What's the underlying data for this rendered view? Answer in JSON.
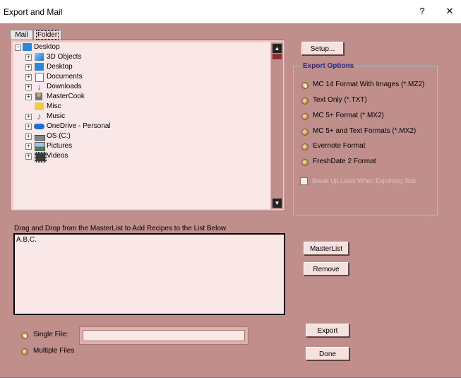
{
  "window": {
    "title": "Export and Mail",
    "help": "?",
    "close": "✕"
  },
  "tabs": [
    {
      "label": "Mail"
    },
    {
      "label": "Folder"
    }
  ],
  "tree": [
    {
      "label": "Desktop",
      "icon": "desktop-icon",
      "expander": "−"
    },
    {
      "label": "3D Objects",
      "icon": "cube-icon",
      "expander": "+"
    },
    {
      "label": "Desktop",
      "icon": "desktop-icon",
      "expander": "+"
    },
    {
      "label": "Documents",
      "icon": "document-icon",
      "expander": "+"
    },
    {
      "label": "Downloads",
      "icon": "download-icon",
      "expander": "+"
    },
    {
      "label": "MasterCook",
      "icon": "user-icon",
      "expander": "+"
    },
    {
      "label": "Misc",
      "icon": "folder-icon",
      "expander": ""
    },
    {
      "label": "Music",
      "icon": "music-icon",
      "expander": "+"
    },
    {
      "label": "OneDrive - Personal",
      "icon": "cloud-icon",
      "expander": "+"
    },
    {
      "label": "OS (C:)",
      "icon": "drive-icon",
      "expander": "+"
    },
    {
      "label": "Pictures",
      "icon": "picture-icon",
      "expander": "+"
    },
    {
      "label": "Videos",
      "icon": "video-icon",
      "expander": "+"
    }
  ],
  "scroll": {
    "up": "▲",
    "down": "▼"
  },
  "buttons": {
    "setup": "Setup...",
    "masterlist": "MasterList",
    "remove": "Remove",
    "export": "Export",
    "done": "Done"
  },
  "export_options": {
    "title": "Export Options",
    "options": [
      {
        "label": "MC 14 Format With Images (*.MZ2)",
        "selected": true
      },
      {
        "label": "Text Only (*.TXT)",
        "selected": false
      },
      {
        "label": "MC 5+ Format (*.MX2)",
        "selected": false
      },
      {
        "label": "MC 5+ and Text Formats (*.MX2)",
        "selected": false
      },
      {
        "label": "Evernote Format",
        "selected": false
      },
      {
        "label": "FreshDate 2 Format",
        "selected": false
      }
    ],
    "break_lines": {
      "label": "Break Up Lines When Exporting Text",
      "checked": false,
      "enabled": false
    }
  },
  "drag_hint": "Drag and Drop from the MasterList to Add Recipes to the  List Below",
  "recipe_list": [
    "A.B.C."
  ],
  "file_mode": {
    "single_label": "Single File:",
    "multiple_label": "Multiple Files",
    "selected": "single",
    "filename": ""
  },
  "colors": {
    "background": "#c08f8c",
    "panel": "#f9e8e7",
    "group_border": "#7ed0da"
  }
}
